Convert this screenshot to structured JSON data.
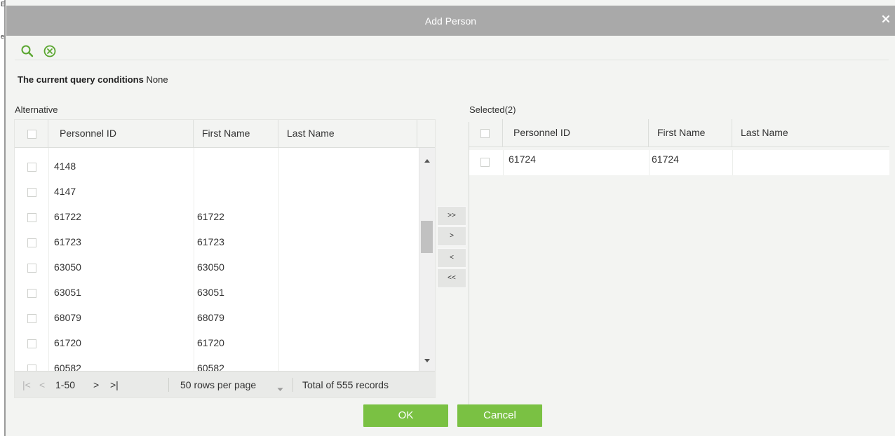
{
  "dialog": {
    "title": "Add Person",
    "close_icon": "close-icon"
  },
  "toolbar": {
    "search_icon": "search-icon",
    "clear_icon": "clear-circle-icon"
  },
  "query": {
    "label": "The current query conditions",
    "value": "None"
  },
  "alternative": {
    "title": "Alternative",
    "columns": [
      "Personnel ID",
      "First Name",
      "Last Name"
    ],
    "rows": [
      {
        "id": "4148",
        "first": "",
        "last": ""
      },
      {
        "id": "4147",
        "first": "",
        "last": ""
      },
      {
        "id": "61722",
        "first": "61722",
        "last": ""
      },
      {
        "id": "61723",
        "first": "61723",
        "last": ""
      },
      {
        "id": "63050",
        "first": "63050",
        "last": ""
      },
      {
        "id": "63051",
        "first": "63051",
        "last": ""
      },
      {
        "id": "68079",
        "first": "68079",
        "last": ""
      },
      {
        "id": "61720",
        "first": "61720",
        "last": ""
      },
      {
        "id": "60582",
        "first": "60582",
        "last": ""
      }
    ],
    "pager": {
      "first": "|<",
      "prev": "<",
      "range": "1-50",
      "next": ">",
      "last": ">|",
      "rows_per_page": "50 rows per page",
      "total": "Total of 555 records"
    }
  },
  "transfer": {
    "move_all_right": ">>",
    "move_right": ">",
    "move_left": "<",
    "move_all_left": "<<"
  },
  "selected": {
    "title": "Selected(2)",
    "columns": [
      "Personnel ID",
      "First Name",
      "Last Name"
    ],
    "rows": [
      {
        "id": "61724",
        "first": "61724",
        "last": ""
      }
    ]
  },
  "buttons": {
    "ok": "OK",
    "cancel": "Cancel"
  },
  "colors": {
    "accent_green": "#7ac143",
    "titlebar": "#a9a9a9"
  }
}
